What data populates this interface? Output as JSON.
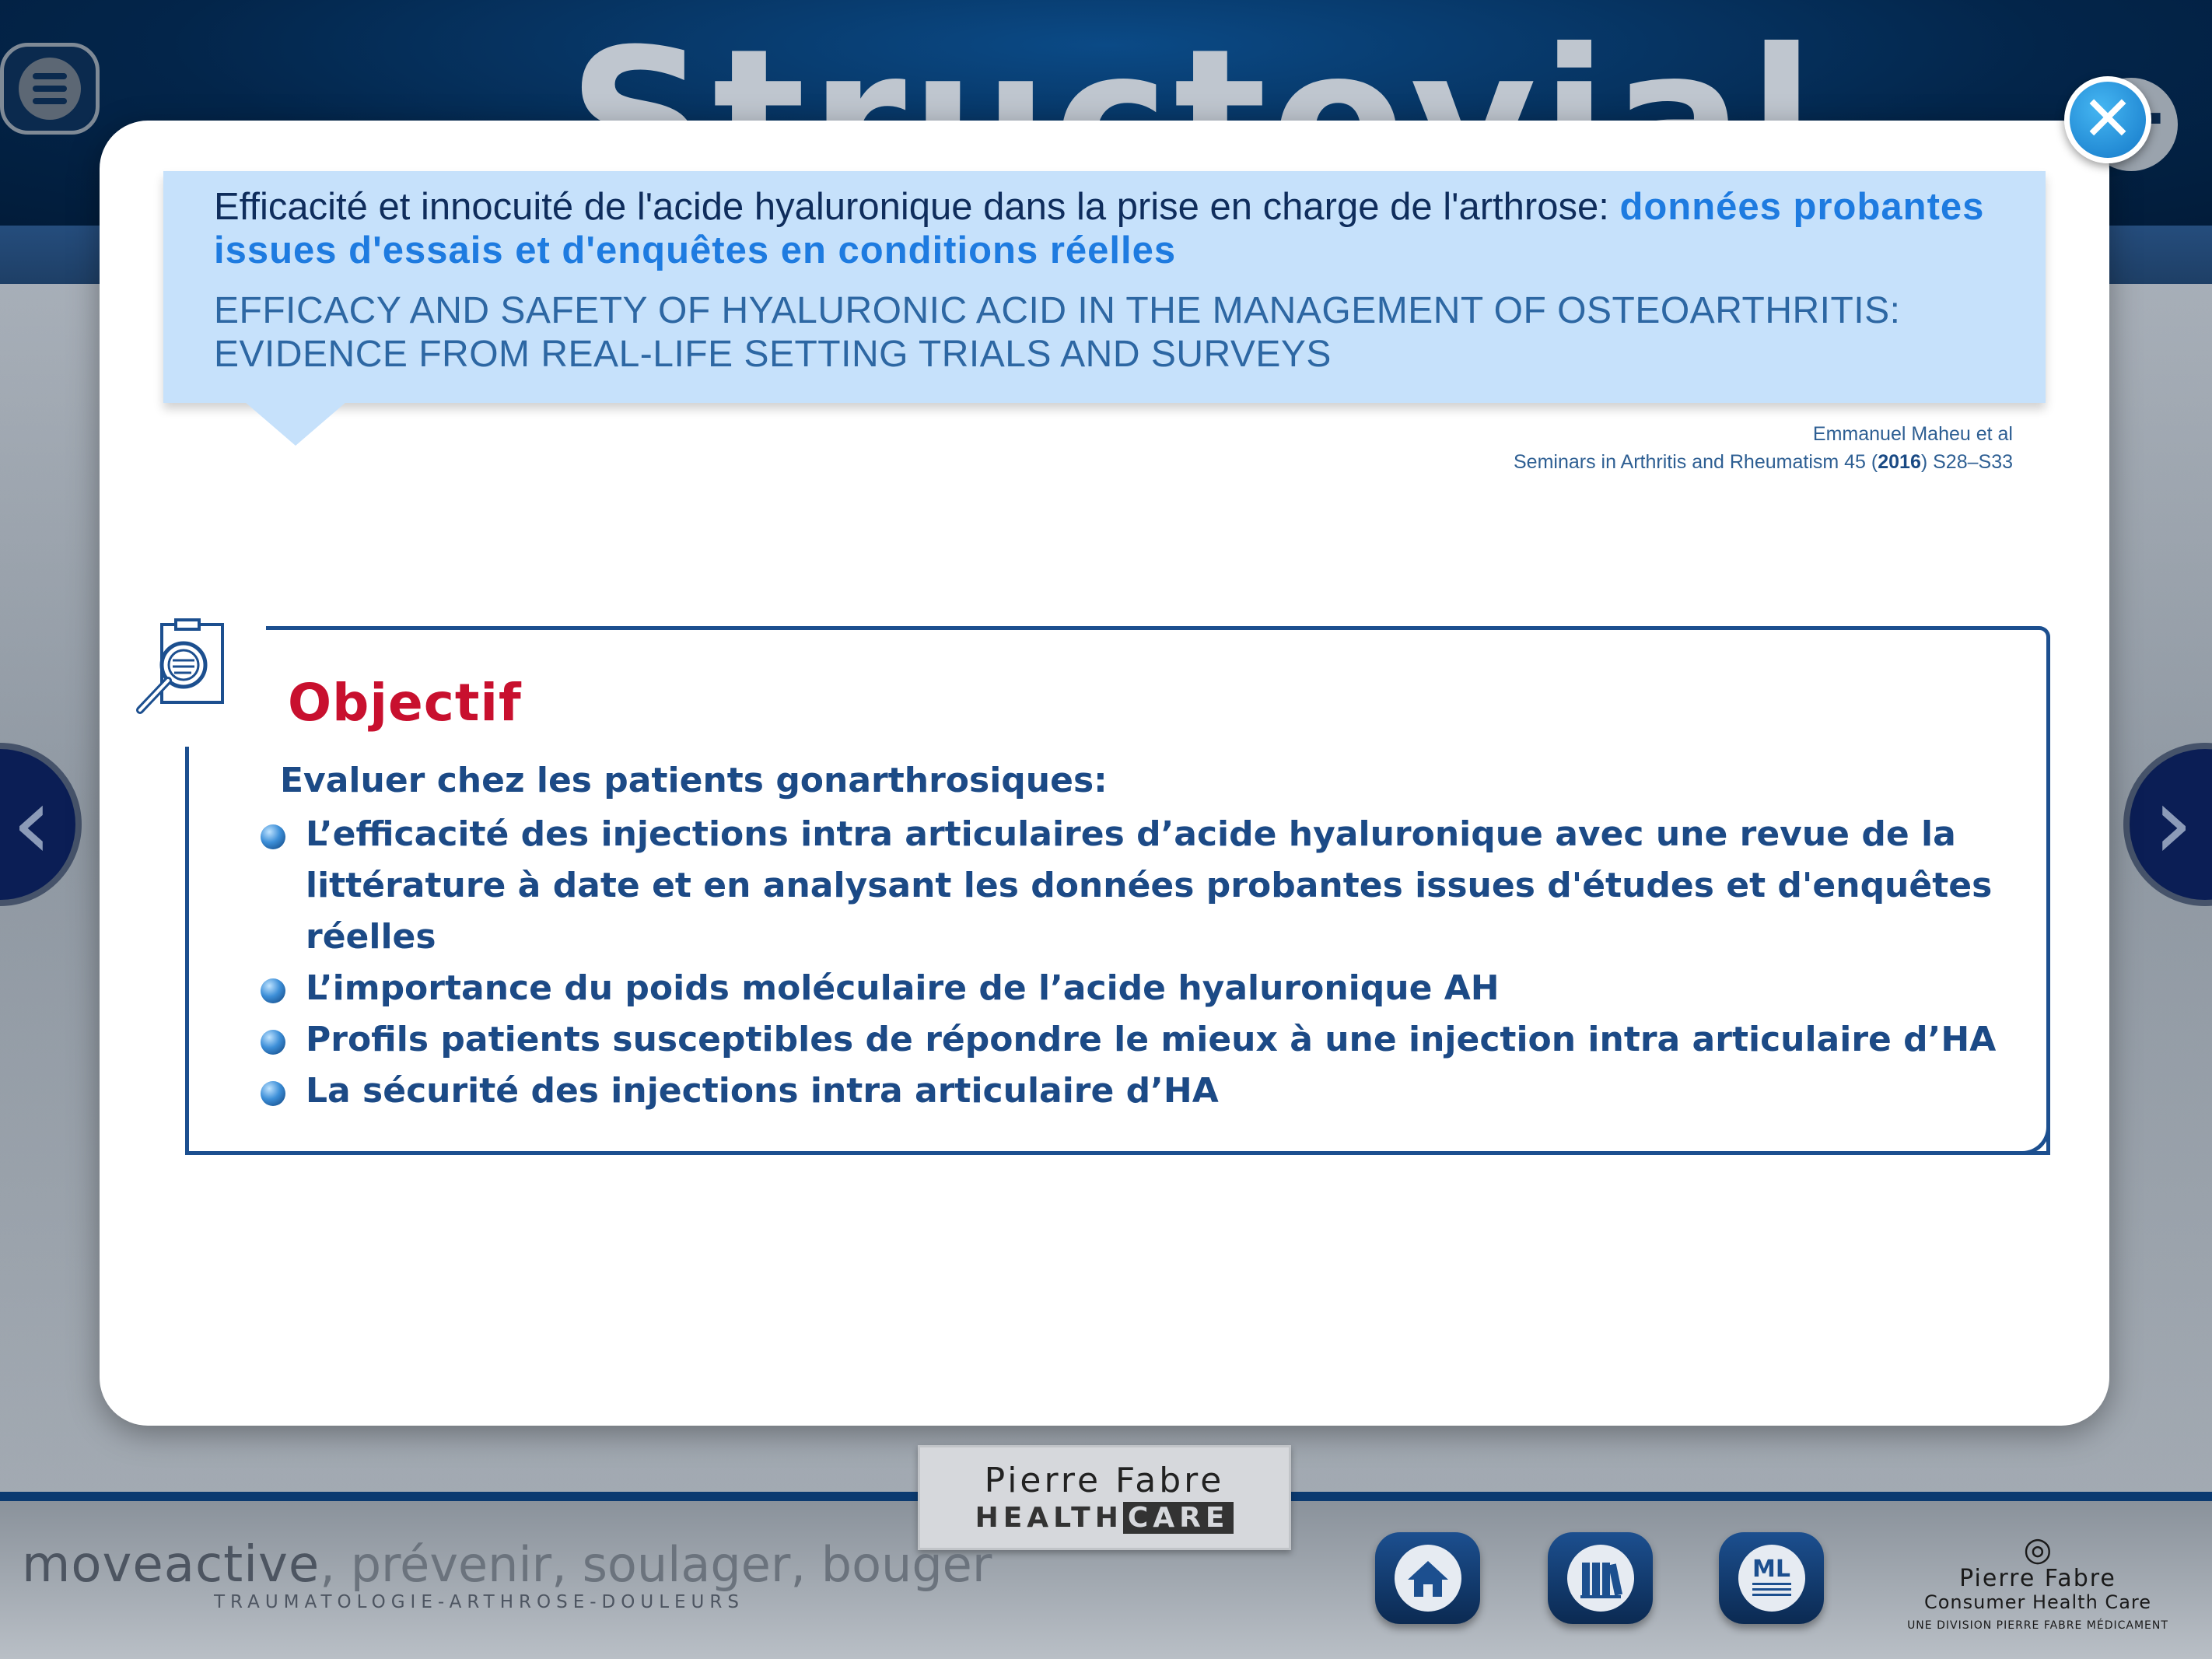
{
  "background": {
    "title": "Structovial"
  },
  "modal": {
    "title_fr_main": "Efficacité et innocuité de l'acide hyaluronique dans la prise en charge de l'arthrose: ",
    "title_fr_highlight": "données probantes issues d'essais et d'enquêtes en conditions réelles",
    "title_en": "EFFICACY AND SAFETY OF HYALURONIC ACID IN THE MANAGEMENT OF OSTEOARTHRITIS: EVIDENCE FROM REAL-LIFE SETTING TRIALS AND SURVEYS",
    "citation_authors": "Emmanuel Maheu et al",
    "citation_journal_before": "Seminars in Arthritis and Rheumatism 45 (",
    "citation_year": "2016",
    "citation_journal_after": ") S28–S33",
    "objective": {
      "heading": "Objectif",
      "intro": "Evaluer chez les patients gonarthrosiques:",
      "items": [
        "L’efficacité des injections intra articulaires d’acide hyaluronique avec une revue de la littérature à date et en analysant les données probantes issues d'études et d'enquêtes réelles",
        "L’importance du poids moléculaire de l’acide hyaluronique AH",
        "Profils patients susceptibles de répondre le mieux à une injection intra articulaire d’HA",
        "La sécurité des injections intra articulaire d’HA"
      ]
    }
  },
  "footer": {
    "brand": "moveactive",
    "slogan": ", prévenir, soulager, bouger",
    "subline": "TRAUMATOLOGIE-ARTHROSE-DOULEURS",
    "center_logo_line1": "Pierre Fabre",
    "center_logo_health": "HEALTH",
    "center_logo_care": "CARE",
    "nav": [
      {
        "icon": "home-icon"
      },
      {
        "icon": "library-icon"
      },
      {
        "icon": "ml-icon",
        "label": "ML"
      }
    ],
    "right_logo_name": "Pierre Fabre",
    "right_logo_division": "Consumer Health Care",
    "right_logo_sub": "UNE DIVISION PIERRE FABRE MÉDICAMENT"
  },
  "colors": {
    "accent": "#1e7be0",
    "heading_red": "#c8102e",
    "text_blue": "#1c4a86",
    "title_box_bg": "#c6e1fb"
  }
}
